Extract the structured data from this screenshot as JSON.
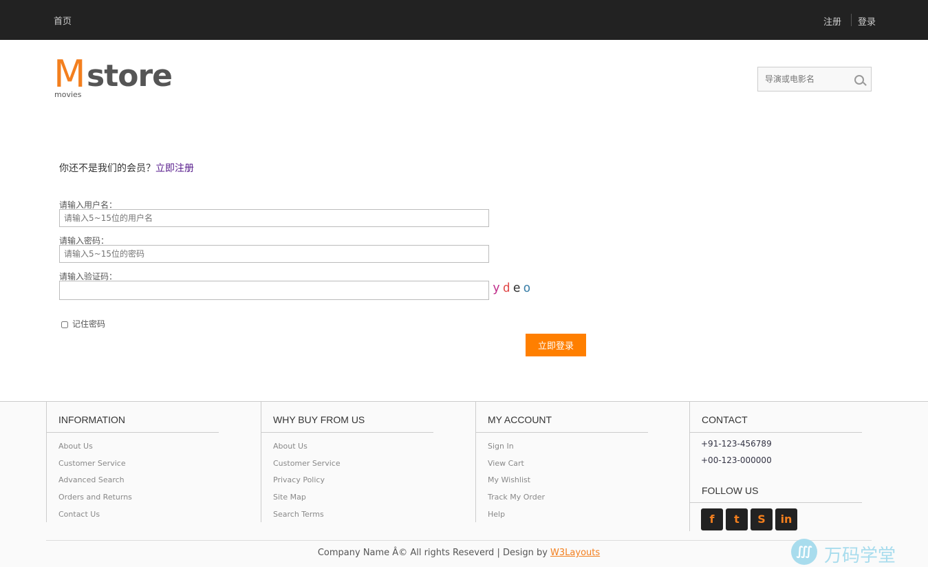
{
  "topbar": {
    "home": "首页",
    "register": "注册",
    "login": "登录"
  },
  "logo": {
    "m": "M",
    "store": "store",
    "movies": "movies"
  },
  "search": {
    "placeholder": "导演或电影名"
  },
  "member": {
    "prompt": "你还不是我们的会员？",
    "link": "立即注册"
  },
  "form": {
    "username_label": "请输入用户名：",
    "username_placeholder": "请输入5~15位的用户名",
    "password_label": "请输入密码：",
    "password_placeholder": "请输入5~15位的密码",
    "captcha_label": "请输入验证码：",
    "captcha_chars": [
      "y",
      "d",
      "e",
      "o"
    ],
    "remember": "记住密码",
    "submit": "立即登录"
  },
  "footer": {
    "information": {
      "title": "INFORMATION",
      "items": [
        "About Us",
        "Customer Service",
        "Advanced Search",
        "Orders and Returns",
        "Contact Us"
      ]
    },
    "why": {
      "title": "WHY BUY FROM US",
      "items": [
        "About Us",
        "Customer Service",
        "Privacy Policy",
        "Site Map",
        "Search Terms"
      ]
    },
    "account": {
      "title": "MY ACCOUNT",
      "items": [
        "Sign In",
        "View Cart",
        "My Wishlist",
        "Track My Order",
        "Help"
      ]
    },
    "contact": {
      "title": "CONTACT",
      "phone1": "+91-123-456789",
      "phone2": "+00-123-000000",
      "follow": "FOLLOW US"
    }
  },
  "copyright": {
    "text": "Company Name Â© All rights Reseverd | Design by ",
    "link": "W3Layouts"
  },
  "watermark": {
    "text": "万码学堂"
  }
}
